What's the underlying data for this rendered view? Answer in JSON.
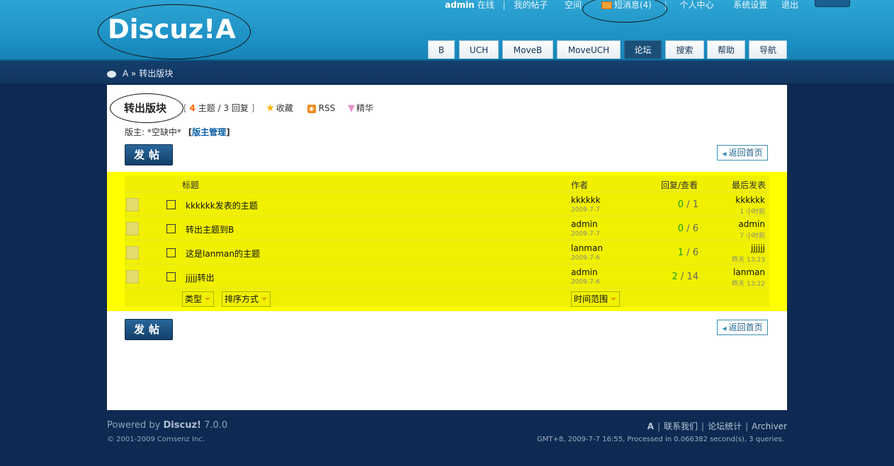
{
  "header": {
    "logo": "Discuz!A",
    "topnav": {
      "username": "admin",
      "online": "在线",
      "my_posts": "我的帖子",
      "space": "空间",
      "messages": "短消息(4)",
      "profile": "个人中心",
      "settings": "系统设置",
      "logout": "退出"
    },
    "tabs": [
      "B",
      "UCH",
      "MoveB",
      "MoveUCH",
      "论坛",
      "搜索",
      "帮助",
      "导航"
    ],
    "active_tab": "论坛"
  },
  "breadcrumb": {
    "home": "A",
    "sep": "»",
    "current": "转出版块"
  },
  "forum": {
    "title": "转出版块",
    "threads": "4",
    "threads_label": "主题",
    "replies": "3",
    "replies_label": "回复",
    "favorite": "收藏",
    "rss": "RSS",
    "digest": "精华",
    "moderator_label": "版主: *空缺中*",
    "moderator_manage": "版主管理"
  },
  "buttons": {
    "post": "发帖",
    "back_home": "返回首页"
  },
  "table": {
    "headers": {
      "subject": "标题",
      "author": "作者",
      "replies_views": "回复/查看",
      "last_post": "最后发表"
    },
    "rows": [
      {
        "subject": "kkkkkk发表的主题",
        "author": "kkkkkk",
        "date": "2009-7-7",
        "replies": "0",
        "views": "1",
        "last_by": "kkkkkk",
        "last_time": "1 小时前"
      },
      {
        "subject": "转出主题到B",
        "author": "admin",
        "date": "2009-7-7",
        "replies": "0",
        "views": "6",
        "last_by": "admin",
        "last_time": "7 小时前"
      },
      {
        "subject": "这是lanman的主题",
        "author": "lanman",
        "date": "2009-7-6",
        "replies": "1",
        "views": "6",
        "last_by": "jjjjjj",
        "last_time": "昨天 13:23"
      },
      {
        "subject": "jjjjj转出",
        "author": "admin",
        "date": "2009-7-6",
        "replies": "2",
        "views": "14",
        "last_by": "lanman",
        "last_time": "昨天 13:22"
      }
    ],
    "filters": {
      "type": "类型",
      "sort": "排序方式",
      "time_range": "时间范围"
    }
  },
  "footer": {
    "powered_prefix": "Powered by",
    "brand": "Discuz!",
    "version": "7.0.0",
    "copyright": "© 2001-2009 Comsenz Inc.",
    "links": {
      "home": "A",
      "contact": "联系我们",
      "stats": "论坛统计",
      "archiver": "Archiver"
    },
    "info": "GMT+8, 2009-7-7 16:55, Processed in 0.066382 second(s), 3 queries."
  },
  "colors": {
    "header_blue": "#1c8fc3",
    "page_navy": "#0e2a52",
    "highlight_yellow": "#ffff00",
    "reply_green": "#1aa01a",
    "thread_count_orange": "#ff6600"
  }
}
